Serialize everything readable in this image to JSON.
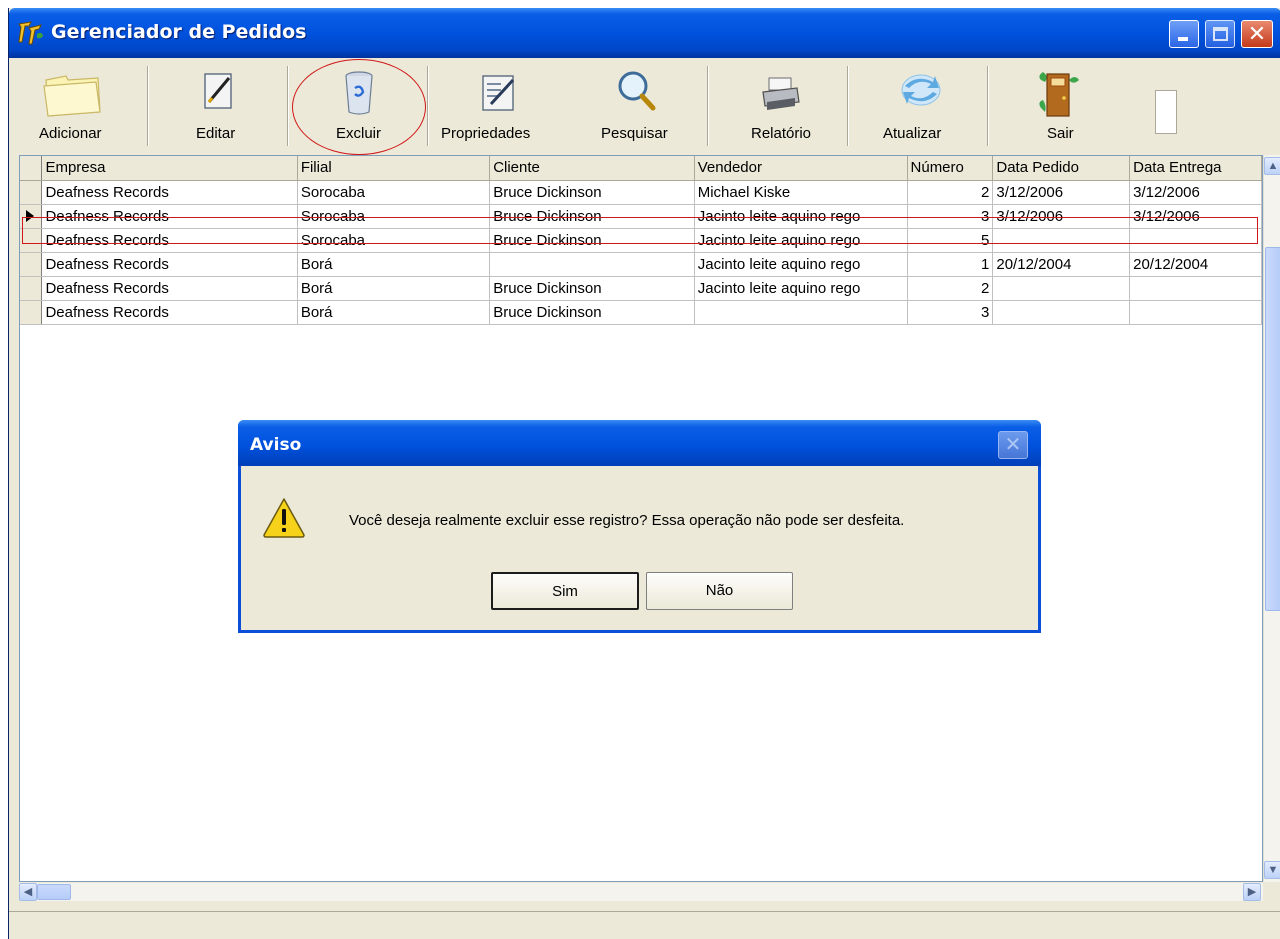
{
  "window": {
    "title": "Gerenciador de Pedidos"
  },
  "toolbar": {
    "adicionar_label": "Adicionar",
    "editar_label": "Editar",
    "excluir_label": "Excluir",
    "propriedades_label": "Propriedades",
    "pesquisar_label": "Pesquisar",
    "relatorio_label": "Relatório",
    "atualizar_label": "Atualizar",
    "sair_label": "Sair"
  },
  "grid": {
    "columns": [
      "Empresa",
      "Filial",
      "Cliente",
      "Vendedor",
      "Número",
      "Data Pedido",
      "Data Entrega"
    ],
    "rows": [
      {
        "empresa": "Deafness Records",
        "filial": "Sorocaba",
        "cliente": "Bruce Dickinson",
        "vendedor": "Michael Kiske",
        "numero": "2",
        "data_pedido": "3/12/2006",
        "data_entrega": "3/12/2006"
      },
      {
        "empresa": "Deafness Records",
        "filial": "Sorocaba",
        "cliente": "Bruce Dickinson",
        "vendedor": "Jacinto leite aquino rego",
        "numero": "3",
        "data_pedido": "3/12/2006",
        "data_entrega": "3/12/2006"
      },
      {
        "empresa": "Deafness Records",
        "filial": "Sorocaba",
        "cliente": "Bruce Dickinson",
        "vendedor": "Jacinto leite aquino rego",
        "numero": "5",
        "data_pedido": "",
        "data_entrega": ""
      },
      {
        "empresa": "Deafness Records",
        "filial": "Borá",
        "cliente": "",
        "vendedor": "Jacinto leite aquino rego",
        "numero": "1",
        "data_pedido": "20/12/2004",
        "data_entrega": "20/12/2004"
      },
      {
        "empresa": "Deafness Records",
        "filial": "Borá",
        "cliente": "Bruce Dickinson",
        "vendedor": "Jacinto leite aquino rego",
        "numero": "2",
        "data_pedido": "",
        "data_entrega": ""
      },
      {
        "empresa": "Deafness Records",
        "filial": "Borá",
        "cliente": "Bruce Dickinson",
        "vendedor": "",
        "numero": "3",
        "data_pedido": "",
        "data_entrega": ""
      }
    ],
    "selected_row": 1
  },
  "dialog": {
    "title": "Aviso",
    "message": "Você deseja realmente excluir esse registro? Essa operação não pode ser desfeita.",
    "yes_label": "Sim",
    "no_label": "Não"
  },
  "colors": {
    "titlebar": "#0052de",
    "highlight": "#d01818",
    "face": "#ece9d8"
  }
}
